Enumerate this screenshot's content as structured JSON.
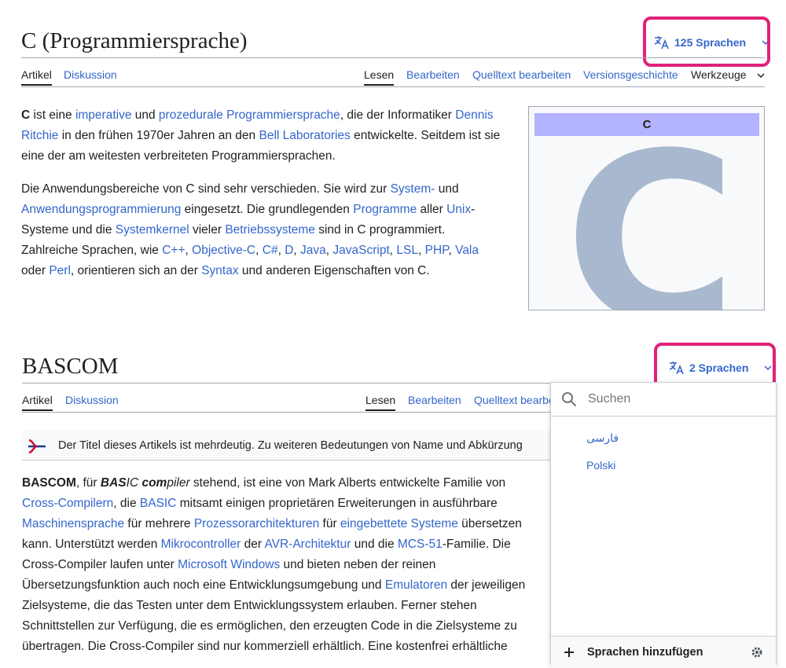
{
  "article1": {
    "title": "C (Programmiersprache)",
    "lang_button": "125 Sprachen",
    "tabs_left": [
      "Artikel",
      "Diskussion"
    ],
    "tabs_right": [
      "Lesen",
      "Bearbeiten",
      "Quelltext bearbeiten",
      "Versionsgeschichte",
      "Werkzeuge"
    ],
    "infobox_title": "C",
    "p1": {
      "t0": "C",
      "t1": " ist eine ",
      "l1": "imperative",
      "t2": " und ",
      "l2": "prozedurale Programmiersprache",
      "t3": ", die der Informatiker ",
      "l3": "Dennis",
      "l4": "Ritchie",
      "t4": " in den frühen 1970er Jahren an den ",
      "l5": "Bell Laboratories",
      "t5": " entwickelte. Seitdem ist sie",
      "t6": "eine der am weitesten verbreiteten Programmiersprachen."
    },
    "p2": {
      "t0": "Die Anwendungsbereiche von C sind sehr verschieden. Sie wird zur ",
      "l1": "System-",
      "t1": " und",
      "l2": "Anwendungsprogrammierung",
      "t2": " eingesetzt. Die grundlegenden ",
      "l3": "Programme",
      "t3": " aller ",
      "l4": "Unix",
      "t4": "-",
      "t5": "Systeme und die ",
      "l5": "Systemkernel",
      "t6": " vieler ",
      "l6": "Betriebssysteme",
      "t7": " sind in C programmiert.",
      "t8": "Zahlreiche Sprachen, wie ",
      "l7": "C++",
      "c1": ", ",
      "l8": "Objective-C",
      "c2": ", ",
      "l9": "C#",
      "c3": ", ",
      "l10": "D",
      "c4": ", ",
      "l11": "Java",
      "c5": ", ",
      "l12": "JavaScript",
      "c6": ", ",
      "l13": "LSL",
      "c7": ", ",
      "l14": "PHP",
      "c8": ", ",
      "l15": "Vala",
      "t9": "oder ",
      "l16": "Perl",
      "t10": ", orientieren sich an der ",
      "l17": "Syntax",
      "t11": " und anderen Eigenschaften von C."
    }
  },
  "article2": {
    "title": "BASCOM",
    "lang_button": "2 Sprachen",
    "tabs_left": [
      "Artikel",
      "Diskussion"
    ],
    "tabs_right": [
      "Lesen",
      "Bearbeiten",
      "Quelltext bearbe"
    ],
    "notice": "Der Titel dieses Artikels ist mehrdeutig. Zu weiteren Bedeutungen von Name und Abkürzung",
    "p1": {
      "b1": "BASCOM",
      "t1": ", für ",
      "bi1": "BAS",
      "i1": "IC ",
      "bi2": "com",
      "i2": "piler",
      "t2": " stehend, ist eine von Mark Alberts entwickelte Familie von",
      "l1": "Cross-Compilern",
      "t3": ", die ",
      "l2": "BASIC",
      "t4": " mitsamt einigen proprietären Erweiterungen in ausführbare",
      "l3": "Maschinensprache",
      "t5": " für mehrere ",
      "l4": "Prozessorarchitekturen",
      "t6": " für ",
      "l5": "eingebettete Systeme",
      "t7": " übersetzen",
      "t8": "kann. Unterstützt werden ",
      "l6": "Mikrocontroller",
      "t9": " der ",
      "l7": "AVR-Architektur",
      "t10": " und die ",
      "l8": "MCS-51",
      "t11": "-Familie. Die",
      "t12": "Cross-Compiler laufen unter ",
      "l9": "Microsoft Windows",
      "t13": " und bieten neben der reinen",
      "t14": "Übersetzungsfunktion auch noch eine Entwicklungsumgebung und ",
      "l10": "Emulatoren",
      "t15": " der jeweiligen",
      "t16": "Zielsysteme, die das Testen unter dem Entwicklungssystem erlauben. Ferner stehen",
      "t17": "Schnittstellen zur Verfügung, die es ermöglichen, den erzeugten Code in die Zielsysteme zu",
      "t18": "übertragen. Die Cross-Compiler sind nur kommerziell erhältlich. Eine kostenfrei erhältliche"
    }
  },
  "dropdown": {
    "search_placeholder": "Suchen",
    "languages": [
      "فارسی",
      "Polski"
    ],
    "add_languages": "Sprachen hinzufügen"
  },
  "colors": {
    "link": "#3366cc",
    "highlight": "#e0217a",
    "infobox_header": "#b3b3ff"
  }
}
